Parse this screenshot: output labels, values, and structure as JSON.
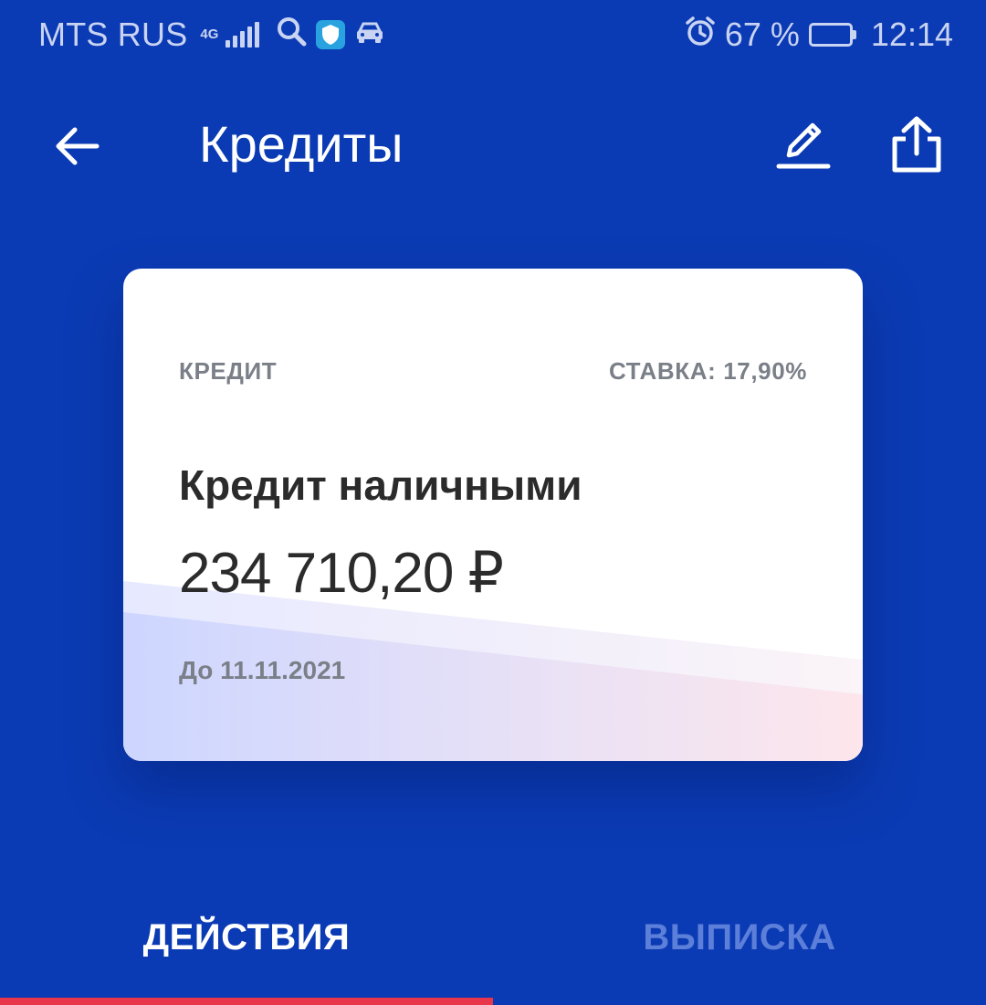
{
  "status_bar": {
    "carrier": "MTS RUS",
    "network": "4G",
    "battery_percent": "67 %",
    "battery_level": 0.67,
    "time": "12:14",
    "icons": [
      "signal-icon",
      "search-icon",
      "shield-app-icon",
      "car-icon",
      "alarm-icon",
      "battery-icon"
    ]
  },
  "app_bar": {
    "title": "Кредиты",
    "icons": [
      "back-arrow-icon",
      "pencil-icon",
      "share-icon"
    ]
  },
  "card": {
    "type_label": "КРЕДИТ",
    "rate_label": "СТАВКА: 17,90%",
    "name": "Кредит наличными",
    "amount": "234 710,20 ₽",
    "due": "До 11.11.2021"
  },
  "tabs": [
    {
      "label": "ДЕЙСТВИЯ",
      "active": true
    },
    {
      "label": "ВЫПИСКА",
      "active": false
    }
  ],
  "colors": {
    "background": "#0b3bb4",
    "card": "#ffffff",
    "active_indicator": "#e8364a",
    "inactive_tab": "#5c7fd9",
    "muted_text": "#7a7f88"
  }
}
